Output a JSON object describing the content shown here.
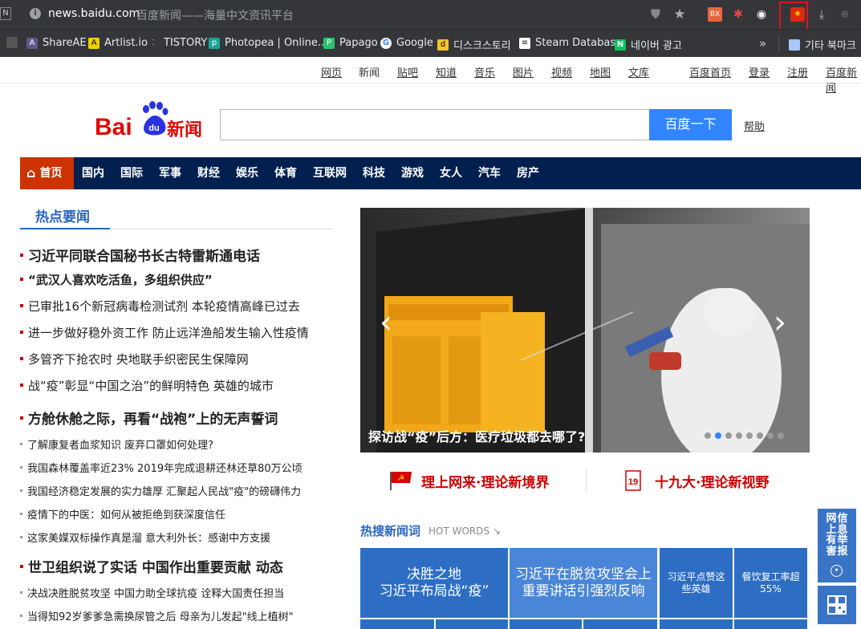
{
  "browser": {
    "tab_icon": "N",
    "url": "news.baidu.com",
    "page_title": "百度新闻——海量中文资讯平台",
    "bookmarks": [
      {
        "label": "ShareAE",
        "icon": "shareae-icon",
        "color": "#555"
      },
      {
        "label": "Artlist.io",
        "icon": "artlist-icon",
        "color": "#f5d000"
      },
      {
        "label": "TISTORY",
        "icon": "tistory-icon",
        "color": "#444"
      },
      {
        "label": "Photopea | Online...",
        "icon": "photopea-icon",
        "color": "#1ea59a"
      },
      {
        "label": "Papago",
        "icon": "papago-icon",
        "color": "#2ec26e"
      },
      {
        "label": "Google",
        "icon": "google-icon",
        "color": "#4285f4"
      },
      {
        "label": "디스크스토리",
        "icon": "diskstory-icon",
        "color": "#f7c325"
      },
      {
        "label": "Steam Database",
        "icon": "steamdb-icon",
        "color": "#222"
      },
      {
        "label": "네이버 광고",
        "icon": "naver-icon",
        "color": "#03c75a"
      }
    ],
    "other_bookmarks": "기타 북마크",
    "ext_bx": "BX",
    "ext_flag": "★"
  },
  "topnav": [
    "网页",
    "新闻",
    "贴吧",
    "知道",
    "音乐",
    "图片",
    "视频",
    "地图",
    "文库",
    "百度首页",
    "登录",
    "注册",
    "百度新闻"
  ],
  "header": {
    "logo_bai": "Bai",
    "logo_du": "du",
    "logo_news": "新闻",
    "search_button": "百度一下",
    "help": "帮助"
  },
  "mainnav": {
    "home": "首页",
    "items": [
      "国内",
      "国际",
      "军事",
      "财经",
      "娱乐",
      "体育",
      "互联网",
      "科技",
      "游戏",
      "女人",
      "汽车",
      "房产"
    ]
  },
  "hot_news": {
    "title": "热点要闻",
    "items": [
      {
        "text": "习近平同联合国秘书长古特雷斯通电话",
        "size": "big"
      },
      {
        "text": "“武汉人喜欢吃活鱼，多组织供应”",
        "size": "mid-bold"
      },
      {
        "text": "已审批16个新冠病毒检测试剂 本轮疫情高峰已过去",
        "size": "mid"
      },
      {
        "text": "进一步做好稳外资工作 防止远洋渔船发生输入性疫情",
        "size": "mid"
      },
      {
        "text": "多管齐下抢农时 央地联手织密民生保障网",
        "size": "mid"
      },
      {
        "text": "战“疫”彰显“中国之治”的鲜明特色 英雄的城市",
        "size": "mid"
      },
      {
        "text": "方舱休舱之际，再看“战袍”上的无声誓词",
        "size": "big"
      },
      {
        "text": "了解康复者血浆知识 废弃口罩如何处理?",
        "size": "small"
      },
      {
        "text": "我国森林覆盖率近23% 2019年完成退耕还林还草80万公顷",
        "size": "small"
      },
      {
        "text": "我国经济稳定发展的实力雄厚 汇聚起人民战\"疫\"的磅礴伟力",
        "size": "small"
      },
      {
        "text": "疫情下的中医：如何从被拒绝到获深度信任",
        "size": "small"
      },
      {
        "text": "这家美媒双标操作真是溜 意大利外长：感谢中方支援",
        "size": "small"
      },
      {
        "text": "世卫组织说了实话 中国作出重要贡献 动态",
        "size": "big"
      },
      {
        "text": "决战决胜脱贫攻坚 中国力助全球抗疫 诠释大国责任担当",
        "size": "small"
      },
      {
        "text": "当得知92岁爹爹急需换尿管之后 母亲为儿发起\"线上植树\"",
        "size": "small"
      }
    ]
  },
  "slideshow": {
    "caption": "探访战“疫”后方：医疗垃圾都去哪了?",
    "prev": "‹",
    "next": "›",
    "dot_count": 8,
    "active_dot": 1
  },
  "banners": {
    "left": "理上网来·理论新境界",
    "right": "十九大·理论新视野",
    "right_badge": "19"
  },
  "hot_search": {
    "title": "热搜新闻词",
    "subtitle": "HOT WORDS ↘",
    "tiles": [
      "决胜之地\n习近平布局战“疫”",
      "习近平在脱贫攻坚会上重要讲话引强烈反响",
      "习近平点赞这些英雄",
      "餐饮复工率超55%"
    ]
  },
  "side": {
    "report_cols": [
      "网上有害",
      "信息举报"
    ],
    "circle": "▾"
  }
}
